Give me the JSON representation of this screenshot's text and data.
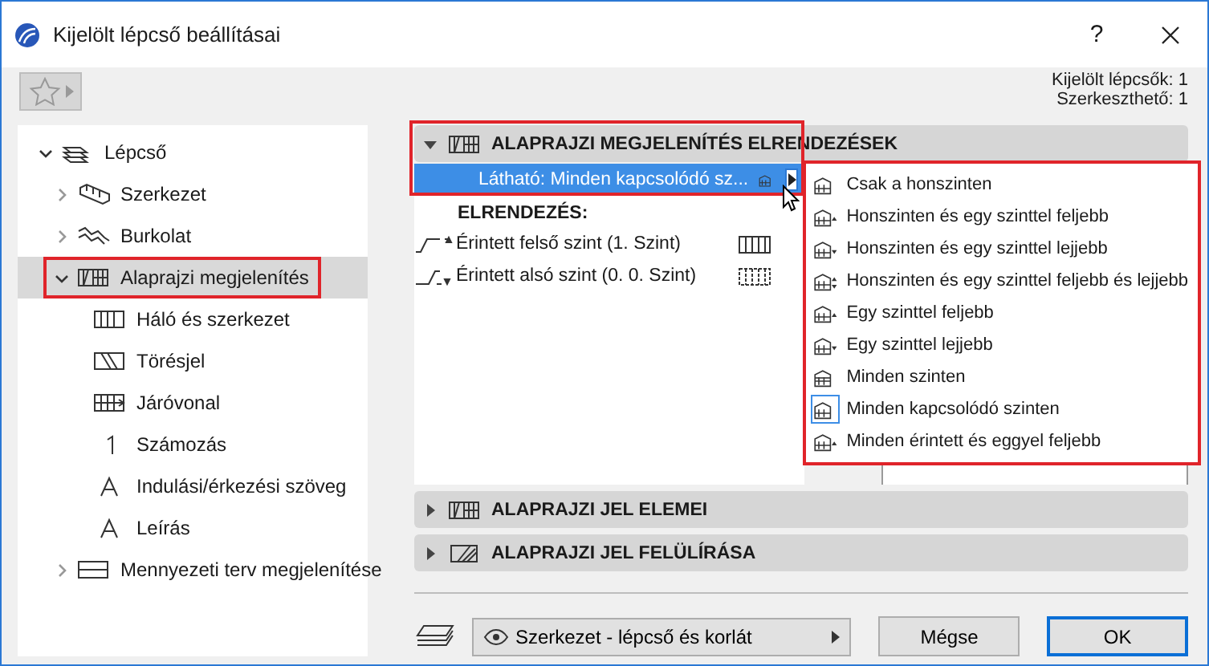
{
  "window": {
    "title": "Kijelölt lépcső beállításai",
    "help": "?"
  },
  "selection_info": [
    "Kijelölt lépcsők: 1",
    "Szerkeszthető: 1"
  ],
  "tree": [
    {
      "label": "Lépcső",
      "kind": "stair",
      "expanded": true,
      "selected": false,
      "highlighted": false,
      "children": [
        {
          "label": "Szerkezet",
          "kind": "structure",
          "expanded": false,
          "selected": false,
          "highlighted": false
        },
        {
          "label": "Burkolat",
          "kind": "finish",
          "expanded": false,
          "selected": false,
          "highlighted": false
        },
        {
          "label": "Alaprajzi megjelenítés",
          "kind": "plan",
          "expanded": true,
          "selected": true,
          "highlighted": true,
          "children": [
            {
              "label": "Háló és szerkezet",
              "kind": "grid",
              "selected": false,
              "highlighted": false
            },
            {
              "label": "Törésjel",
              "kind": "break",
              "selected": false,
              "highlighted": false
            },
            {
              "label": "Járóvonal",
              "kind": "walkline",
              "selected": false,
              "highlighted": false
            },
            {
              "label": "Számozás",
              "kind": "number",
              "selected": false,
              "highlighted": false
            },
            {
              "label": "Indulási/érkezési szöveg",
              "kind": "text",
              "selected": false,
              "highlighted": false
            },
            {
              "label": "Leírás",
              "kind": "text",
              "selected": false,
              "highlighted": false
            }
          ]
        },
        {
          "label": "Mennyezeti terv megjelenítése",
          "kind": "ceiling",
          "expanded": false,
          "selected": false,
          "highlighted": false
        }
      ]
    }
  ],
  "sections": [
    {
      "title": "ALAPRAJZI MEGJELENÍTÉS ELRENDEZÉSEK",
      "kind": "plan",
      "expanded": true,
      "highlighted": true
    },
    {
      "title": "ALAPRAJZI JEL ELEMEI",
      "kind": "plan",
      "expanded": false,
      "highlighted": false
    },
    {
      "title": "ALAPRAJZI JEL FELÜLÍRÁSA",
      "kind": "override",
      "expanded": false,
      "highlighted": false
    }
  ],
  "visible_row": {
    "text": "Látható: Minden kapcsolódó sz...",
    "selected": true
  },
  "layout_label": "ELRENDEZÉS:",
  "layout_rows": [
    {
      "label": "Érintett felső szint (1. Szint)",
      "kind": "upper"
    },
    {
      "label": "Érintett alsó szint (0. 0. Szint)",
      "kind": "lower"
    }
  ],
  "popup": {
    "highlighted": true,
    "items": [
      {
        "label": "Csak a honszinten",
        "kind": "home",
        "selected": false
      },
      {
        "label": "Honszinten és egy szinttel feljebb",
        "kind": "up",
        "selected": false
      },
      {
        "label": "Honszinten és egy szinttel lejjebb",
        "kind": "down",
        "selected": false
      },
      {
        "label": "Honszinten és egy szinttel feljebb és lejjebb",
        "kind": "updown",
        "selected": false
      },
      {
        "label": "Egy szinttel feljebb",
        "kind": "up",
        "selected": false
      },
      {
        "label": "Egy szinttel lejjebb",
        "kind": "down",
        "selected": false
      },
      {
        "label": "Minden szinten",
        "kind": "all",
        "selected": false
      },
      {
        "label": "Minden kapcsolódó szinten",
        "kind": "home",
        "selected": true
      },
      {
        "label": "Minden érintett és eggyel feljebb",
        "kind": "up",
        "selected": false
      }
    ]
  },
  "footer": {
    "layer_combination": "Szerkezet - lépcső és korlát",
    "buttons": [
      {
        "label": "Mégse",
        "default": false
      },
      {
        "label": "OK",
        "default": true
      }
    ]
  }
}
